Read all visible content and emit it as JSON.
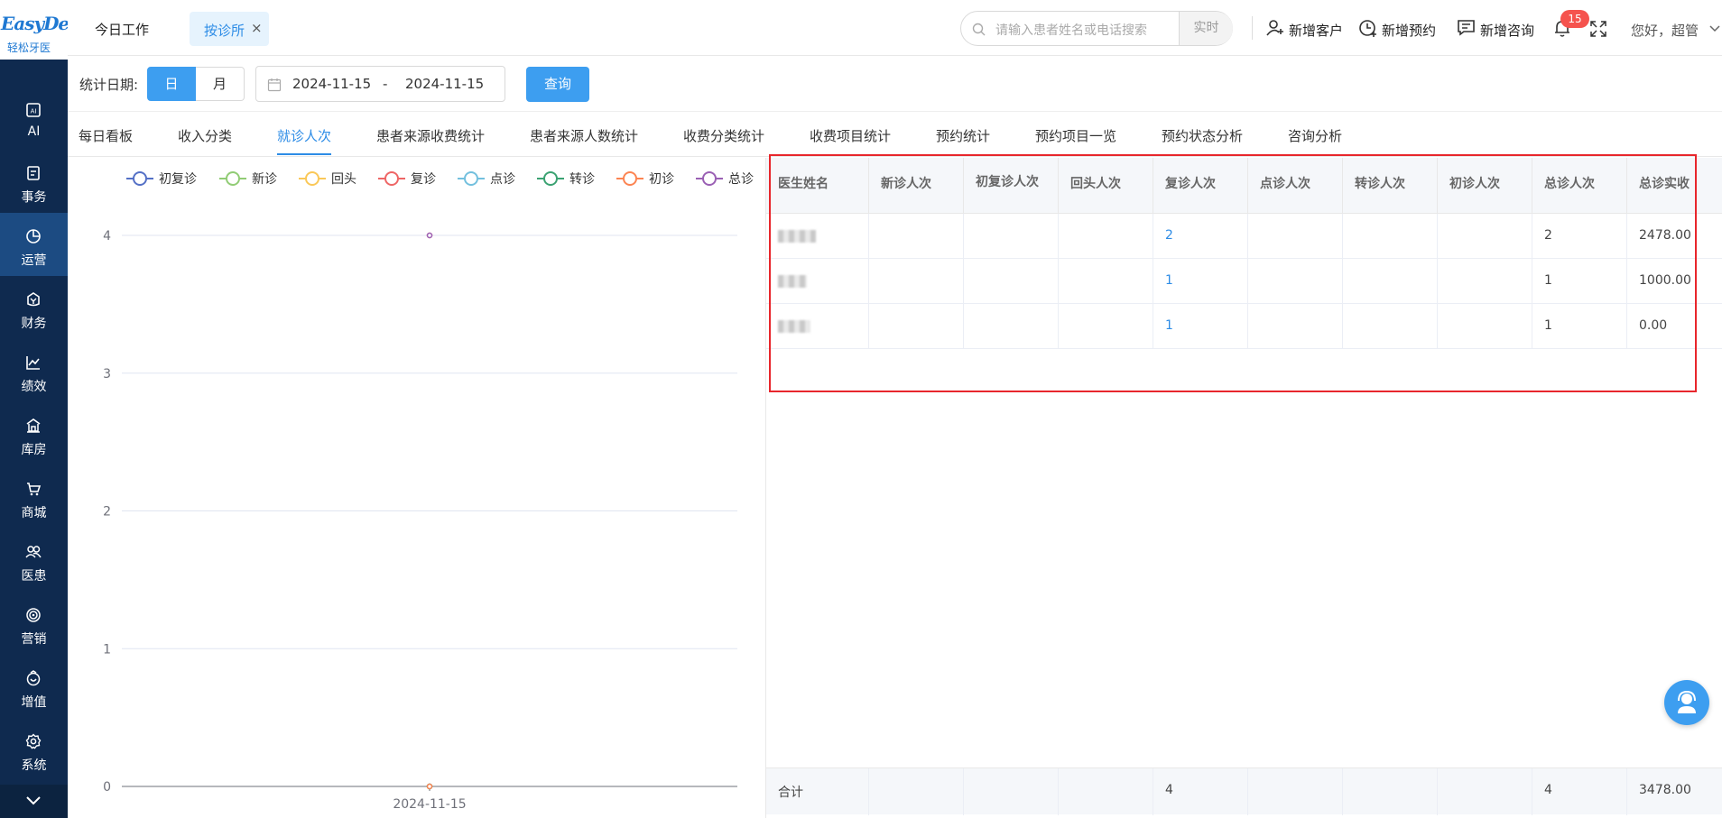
{
  "sidebar": {
    "logo_top": "EasyDent",
    "logo_bottom": "轻松牙医",
    "items": [
      {
        "label": "AI",
        "icon": "ai-icon"
      },
      {
        "label": "事务",
        "icon": "task-icon"
      },
      {
        "label": "运营",
        "icon": "pie-chart-icon",
        "active": true
      },
      {
        "label": "财务",
        "icon": "finance-icon"
      },
      {
        "label": "绩效",
        "icon": "trend-icon"
      },
      {
        "label": "库房",
        "icon": "warehouse-icon"
      },
      {
        "label": "商城",
        "icon": "cart-icon"
      },
      {
        "label": "医患",
        "icon": "patients-icon"
      },
      {
        "label": "营销",
        "icon": "target-icon"
      },
      {
        "label": "增值",
        "icon": "value-added-icon"
      },
      {
        "label": "系统",
        "icon": "gear-icon"
      }
    ]
  },
  "topbar": {
    "tab_today": "今日工作",
    "tab_open": "按诊所",
    "tab_close": "×",
    "search_placeholder": "请输入患者姓名或电话搜索",
    "search_mode": "实时",
    "actions": {
      "new_customer": "新增客户",
      "new_appointment": "新增预约",
      "new_consult": "新增咨询"
    },
    "notification_count": "15",
    "greeting": "您好，超管"
  },
  "filter": {
    "label": "统计日期:",
    "day": "日",
    "month": "月",
    "start_date": "2024-11-15",
    "separator": "-",
    "end_date": "2024-11-15",
    "query": "查询"
  },
  "tabs": [
    "每日看板",
    "收入分类",
    "就诊人次",
    "患者来源收费统计",
    "患者来源人数统计",
    "收费分类统计",
    "收费项目统计",
    "预约统计",
    "预约项目一览",
    "预约状态分析",
    "咨询分析"
  ],
  "active_tab": "就诊人次",
  "chart_data": {
    "type": "line",
    "categories": [
      "2024-11-15"
    ],
    "series": [
      {
        "name": "初复诊",
        "values": [
          0
        ],
        "color": "#5470c6"
      },
      {
        "name": "新诊",
        "values": [
          0
        ],
        "color": "#91cc75"
      },
      {
        "name": "回头",
        "values": [
          0
        ],
        "color": "#fac858"
      },
      {
        "name": "复诊",
        "values": [
          4
        ],
        "color": "#ee6666"
      },
      {
        "name": "点诊",
        "values": [
          0
        ],
        "color": "#73c0de"
      },
      {
        "name": "转诊",
        "values": [
          0
        ],
        "color": "#3ba272"
      },
      {
        "name": "初诊",
        "values": [
          0
        ],
        "color": "#fc8452"
      },
      {
        "name": "总诊",
        "values": [
          4
        ],
        "color": "#9a60b4"
      }
    ],
    "y_ticks": [
      "0",
      "1",
      "2",
      "3",
      "4"
    ],
    "ylim": [
      0,
      4
    ],
    "legend": "top",
    "grid": true
  },
  "table": {
    "columns": [
      "医生姓名",
      "新诊人次",
      "初复诊人次",
      "回头人次",
      "复诊人次",
      "点诊人次",
      "转诊人次",
      "初诊人次",
      "总诊人次",
      "总诊实收"
    ],
    "rows": [
      {
        "new": "",
        "init_re": "",
        "back": "",
        "re": "2",
        "spot": "",
        "transfer": "",
        "first": "",
        "total": "2",
        "paid": "2478.00"
      },
      {
        "new": "",
        "init_re": "",
        "back": "",
        "re": "1",
        "spot": "",
        "transfer": "",
        "first": "",
        "total": "1",
        "paid": "1000.00"
      },
      {
        "new": "",
        "init_re": "",
        "back": "",
        "re": "1",
        "spot": "",
        "transfer": "",
        "first": "",
        "total": "1",
        "paid": "0.00"
      }
    ],
    "footer": {
      "label": "合计",
      "re": "4",
      "total": "4",
      "paid": "3478.00"
    }
  }
}
